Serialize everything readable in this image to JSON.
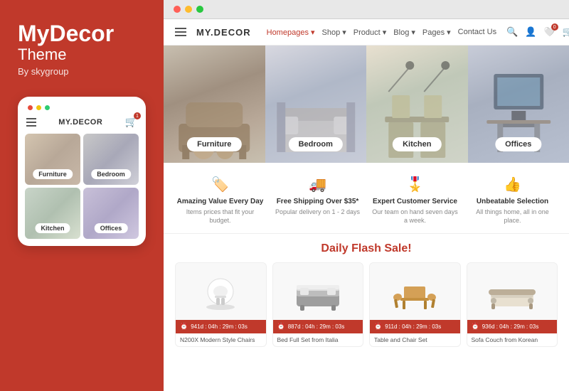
{
  "leftPanel": {
    "brandTitle": "MyDecor",
    "brandSubtitle": "Theme",
    "brandBy": "By skygroup",
    "mobile": {
      "logo": "MY.DECOR",
      "cartBadge": "1",
      "categories": [
        {
          "id": "furniture",
          "label": "Furniture"
        },
        {
          "id": "bedroom",
          "label": "Bedroom"
        },
        {
          "id": "kitchen",
          "label": "Kitchen"
        },
        {
          "id": "offices",
          "label": "Offices"
        }
      ]
    }
  },
  "browser": {
    "dots": [
      "red",
      "yellow",
      "green"
    ]
  },
  "nav": {
    "logo": "MY.DECOR",
    "links": [
      {
        "label": "Homepages",
        "active": true
      },
      {
        "label": "Shop"
      },
      {
        "label": "Product"
      },
      {
        "label": "Blog"
      },
      {
        "label": "Pages"
      },
      {
        "label": "Contact Us"
      }
    ]
  },
  "heroCategories": [
    {
      "id": "furniture",
      "label": "Furniture",
      "bgClass": "bg-furniture"
    },
    {
      "id": "bedroom",
      "label": "Bedroom",
      "bgClass": "bg-bedroom"
    },
    {
      "id": "kitchen",
      "label": "Kitchen",
      "bgClass": "bg-kitchen"
    },
    {
      "id": "offices",
      "label": "Offices",
      "bgClass": "bg-offices"
    }
  ],
  "features": [
    {
      "icon": "🏷️",
      "title": "Amazing Value Every Day",
      "desc": "Items prices that fit your budget."
    },
    {
      "icon": "🚚",
      "title": "Free Shipping Over $35*",
      "desc": "Popular delivery on 1 - 2 days"
    },
    {
      "icon": "🎖️",
      "title": "Expert Customer Service",
      "desc": "Our team on hand seven days a week."
    },
    {
      "icon": "👍",
      "title": "Unbeatable Selection",
      "desc": "All things home, all in one place."
    }
  ],
  "flashSale": {
    "title": "Daily Flash Sale!",
    "products": [
      {
        "name": "N200X Modern Style Chairs",
        "timer": "941d : 04h : 29m : 03s",
        "icon": "🪑"
      },
      {
        "name": "Bed Full Set from Italia",
        "timer": "887d : 04h : 29m : 03s",
        "icon": "🛏️"
      },
      {
        "name": "Table and Chair Set",
        "timer": "911d : 04h : 29m : 03s",
        "icon": "🍽️"
      },
      {
        "name": "Sofa Couch from Korean",
        "timer": "936d : 04h : 29m : 03s",
        "icon": "🛋️"
      }
    ]
  }
}
